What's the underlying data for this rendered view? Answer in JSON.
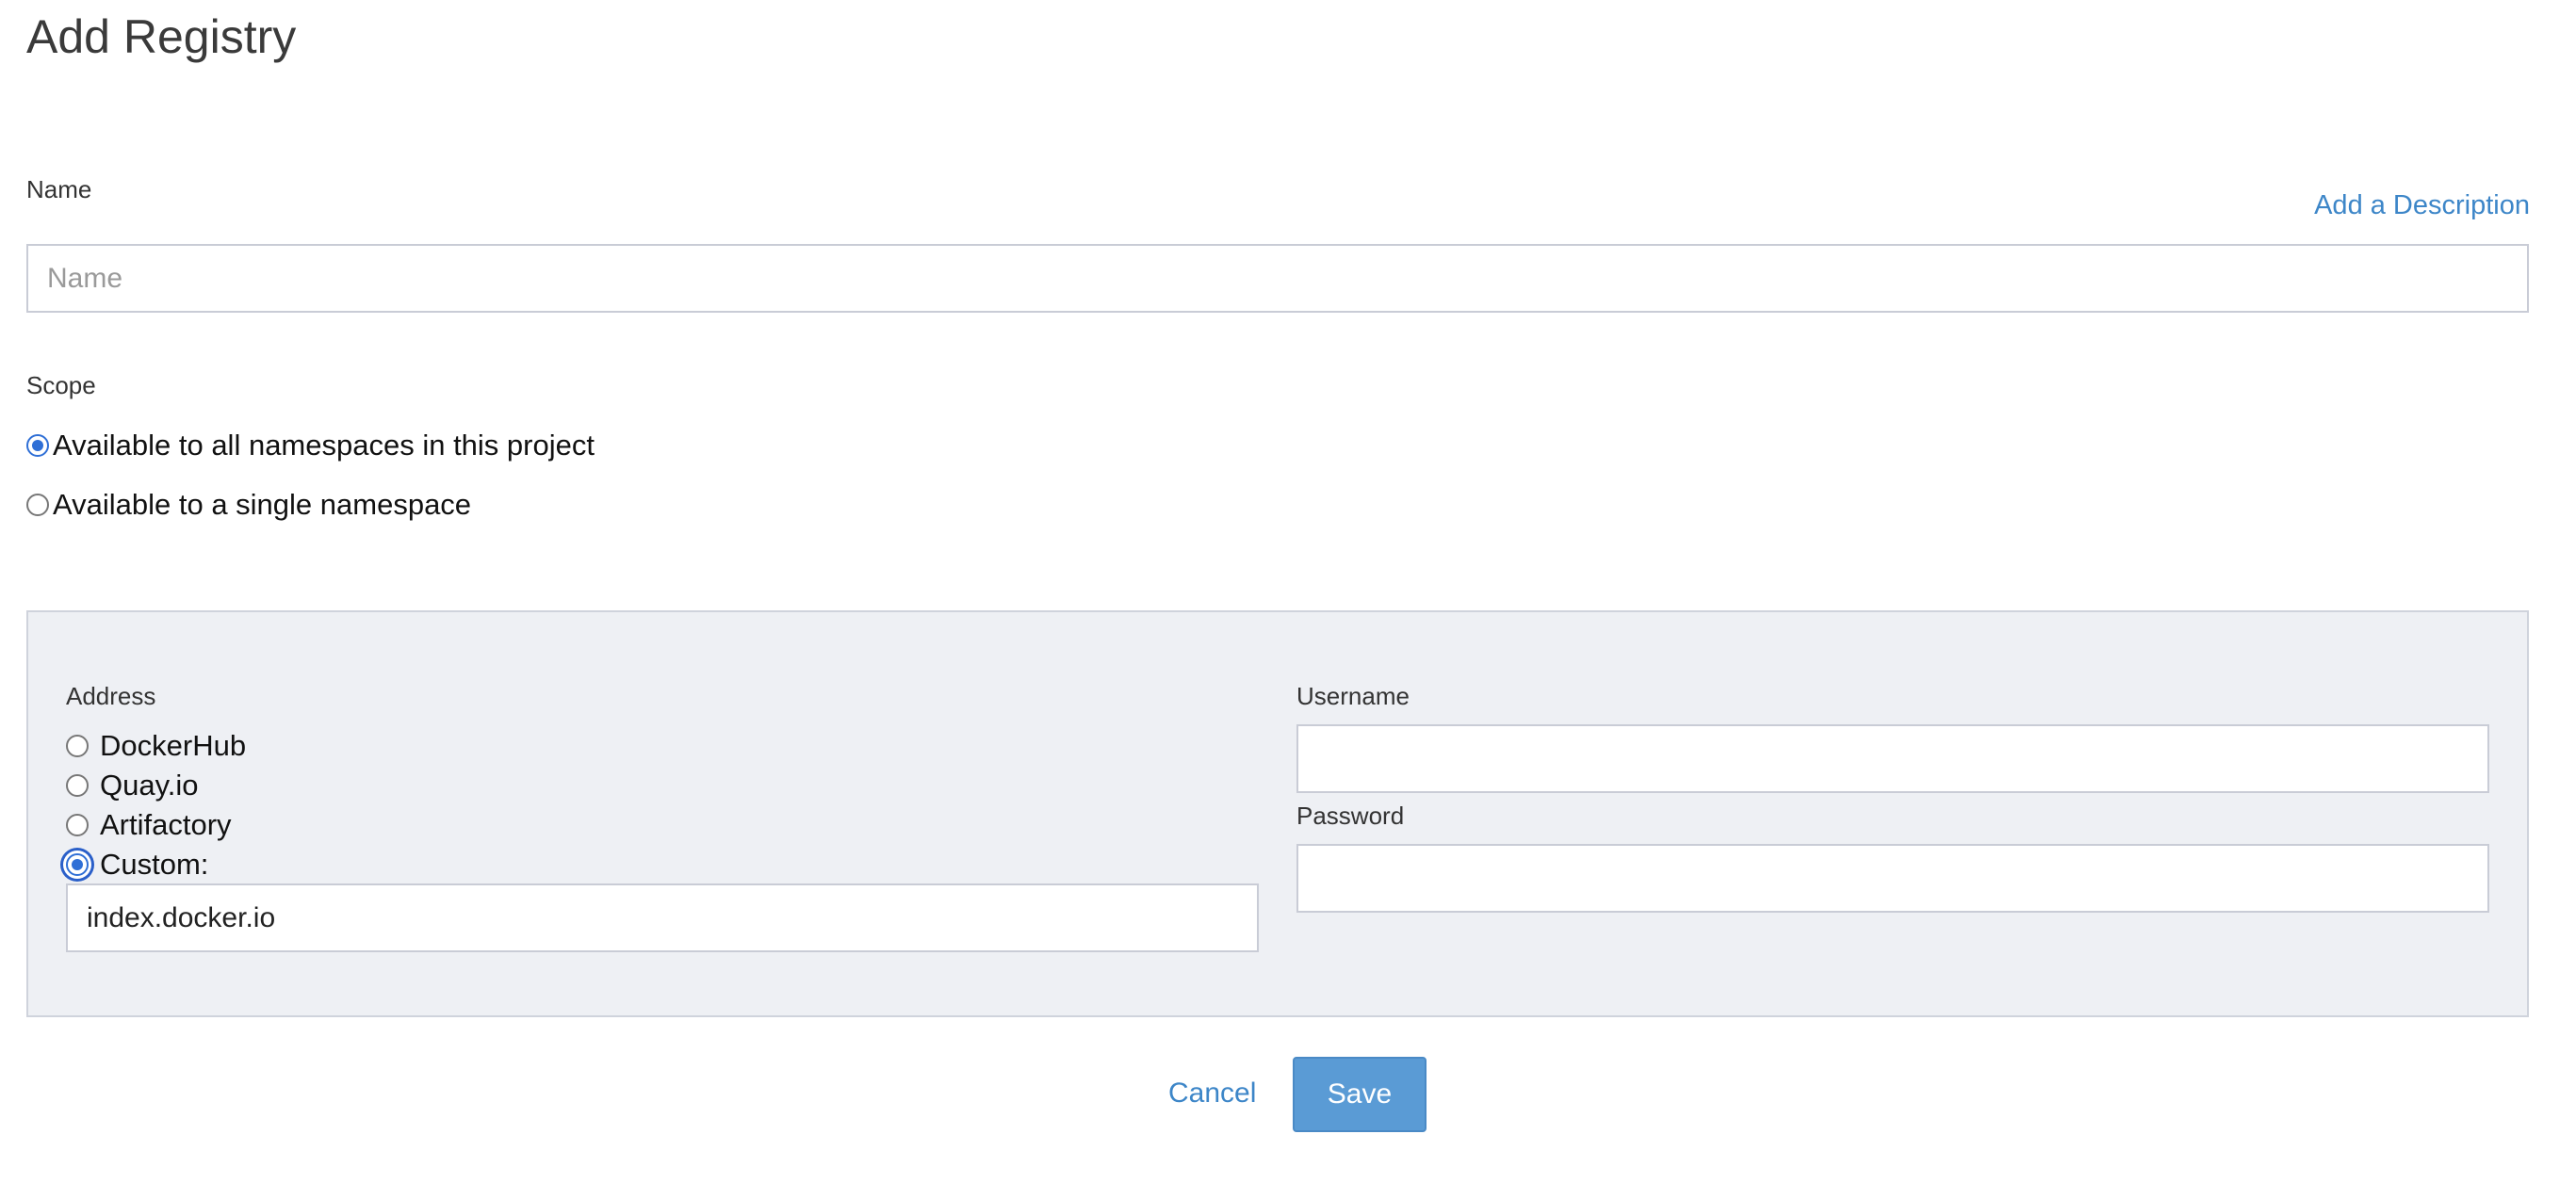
{
  "page": {
    "title": "Add Registry"
  },
  "name_field": {
    "label": "Name",
    "placeholder": "Name",
    "value": "",
    "description_link": "Add a Description"
  },
  "scope": {
    "label": "Scope",
    "options": [
      {
        "label": "Available to all namespaces in this project",
        "checked": true
      },
      {
        "label": "Available to a single namespace",
        "checked": false
      }
    ]
  },
  "address": {
    "label": "Address",
    "options": [
      {
        "label": "DockerHub",
        "checked": false
      },
      {
        "label": "Quay.io",
        "checked": false
      },
      {
        "label": "Artifactory",
        "checked": false
      },
      {
        "label": "Custom:",
        "checked": true
      }
    ],
    "custom_value": "index.docker.io"
  },
  "credentials": {
    "username_label": "Username",
    "username_value": "",
    "password_label": "Password",
    "password_value": ""
  },
  "actions": {
    "cancel_label": "Cancel",
    "save_label": "Save"
  },
  "colors": {
    "accent": "#3d86c8",
    "save_button": "#5a9bd5",
    "panel_bg": "#eef0f4",
    "radio_checked": "#2f6fd6"
  }
}
